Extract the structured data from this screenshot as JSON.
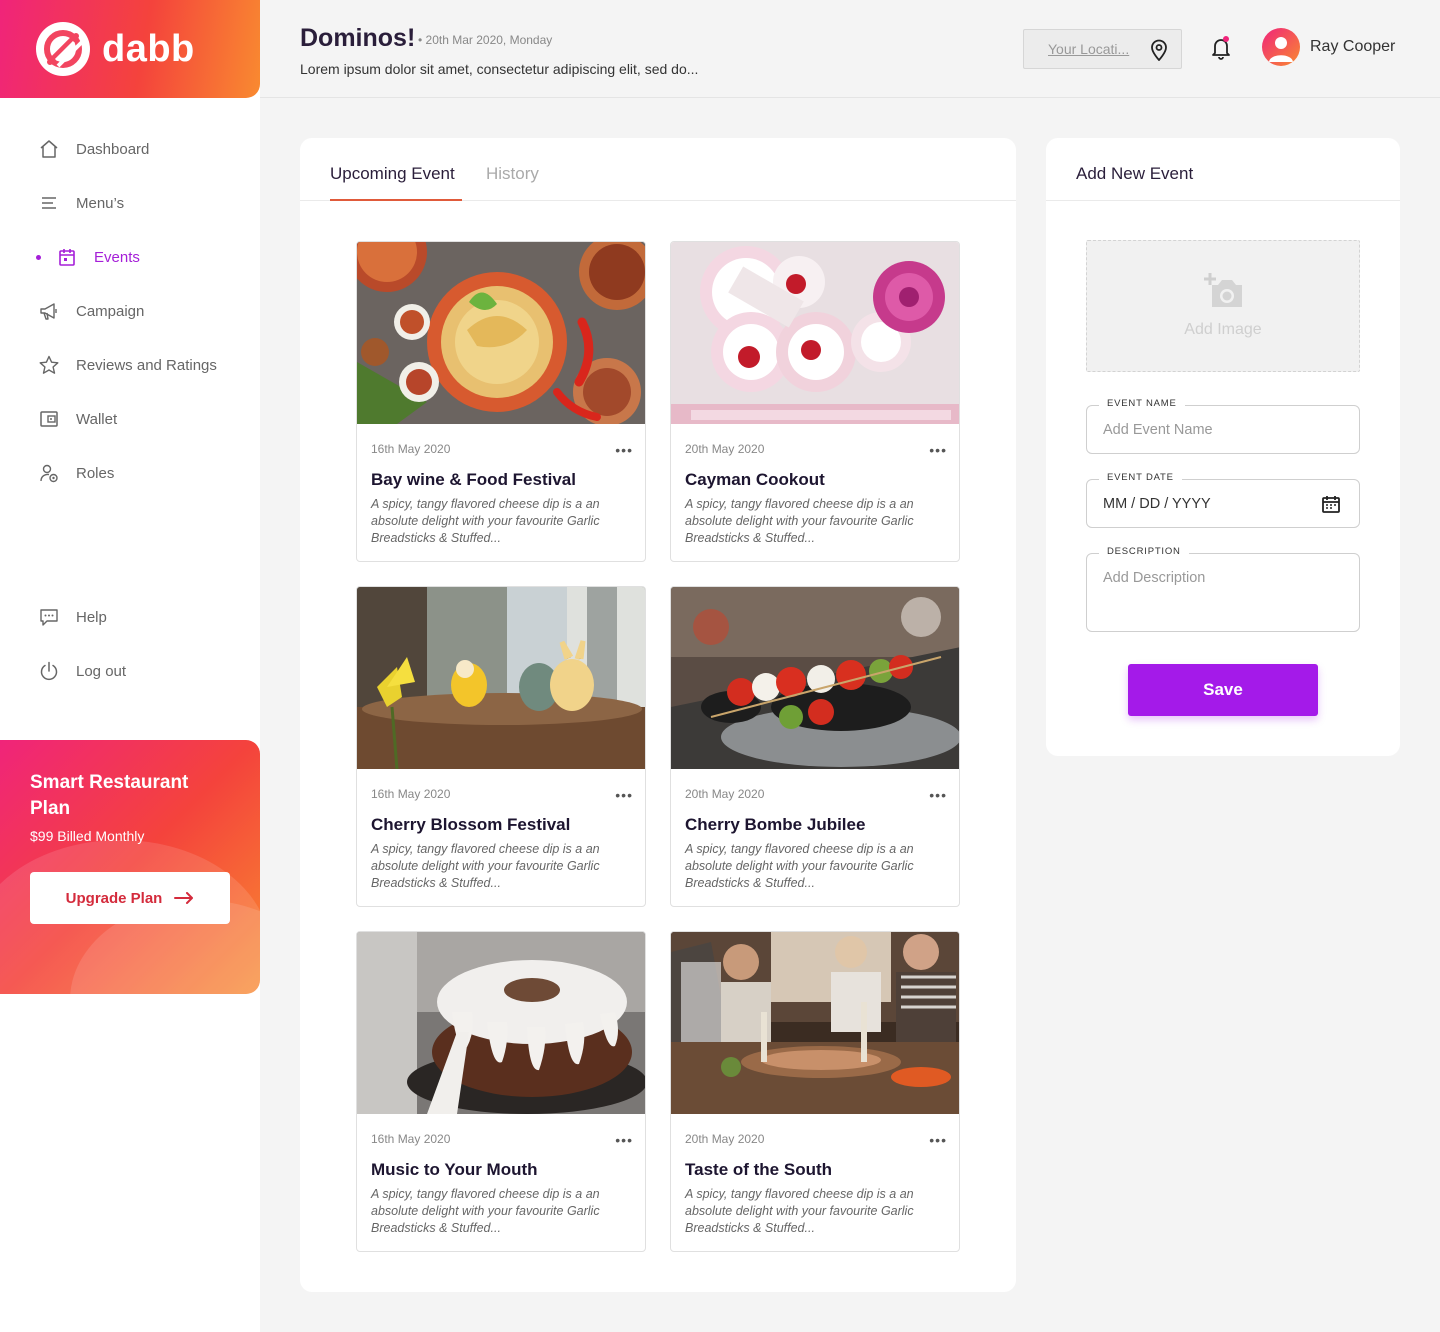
{
  "brand": {
    "name": "dabb"
  },
  "sidebar": {
    "items": [
      {
        "label": "Dashboard",
        "icon": "home-icon"
      },
      {
        "label": "Menu’s",
        "icon": "menu-icon"
      },
      {
        "label": "Events",
        "icon": "calendar-icon",
        "active": true
      },
      {
        "label": "Campaign",
        "icon": "megaphone-icon"
      },
      {
        "label": "Reviews and Ratings",
        "icon": "star-icon"
      },
      {
        "label": "Wallet",
        "icon": "wallet-icon"
      },
      {
        "label": "Roles",
        "icon": "roles-icon"
      }
    ],
    "bottom_items": [
      {
        "label": "Help",
        "icon": "chat-icon"
      },
      {
        "label": "Log out",
        "icon": "power-icon"
      }
    ],
    "promo": {
      "title": "Smart Restaurant Plan",
      "price": "$99 Billed Monthly",
      "button_label": "Upgrade Plan"
    }
  },
  "header": {
    "title": "Dominos!",
    "date": "• 20th Mar 2020, Monday",
    "subtitle": "Lorem ipsum dolor sit amet, consectetur adipiscing elit, sed do...",
    "location_placeholder": "Your Locati...",
    "user_name": "Ray Cooper"
  },
  "events": {
    "tabs": [
      {
        "label": "Upcoming Event",
        "active": true
      },
      {
        "label": "History",
        "active": false
      }
    ],
    "cards": [
      {
        "date": "16th May 2020",
        "title": "Bay wine & Food Festival",
        "description": "A spicy, tangy flavored cheese dip is a an absolute delight with your favourite Garlic Breadsticks & Stuffed...",
        "photo": "noodle-feast"
      },
      {
        "date": "20th May 2020",
        "title": "Cayman Cookout",
        "description": "A spicy, tangy flavored cheese dip is a an absolute delight with your favourite Garlic Breadsticks & Stuffed...",
        "photo": "pink-desserts"
      },
      {
        "date": "16th May 2020",
        "title": "Cherry Blossom Festival",
        "description": "A spicy, tangy flavored cheese dip is a an absolute delight with your favourite Garlic Breadsticks & Stuffed...",
        "photo": "easter-decor"
      },
      {
        "date": "20th May 2020",
        "title": "Cherry Bombe Jubilee",
        "description": "A spicy, tangy flavored cheese dip is a an absolute delight with your favourite Garlic Breadsticks & Stuffed...",
        "photo": "caprese-skewers"
      },
      {
        "date": "16th May 2020",
        "title": "Music to Your Mouth",
        "description": "A spicy, tangy flavored cheese dip is a an absolute delight with your favourite Garlic Breadsticks & Stuffed...",
        "photo": "bundt-cake"
      },
      {
        "date": "20th May 2020",
        "title": "Taste of the South",
        "description": "A spicy, tangy flavored cheese dip is a an absolute delight with your favourite Garlic Breadsticks & Stuffed...",
        "photo": "dinner-party"
      }
    ]
  },
  "add_event": {
    "title": "Add New Event",
    "image_label": "Add Image",
    "fields": {
      "name_label": "EVENT NAME",
      "name_placeholder": "Add Event Name",
      "date_label": "EVENT DATE",
      "date_placeholder": "MM / DD / YYYY",
      "description_label": "DESCRIPTION",
      "description_placeholder": "Add Description"
    },
    "save_label": "Save"
  },
  "colors": {
    "accent": "#a41ae9",
    "brand_gradient_start": "#f0247a",
    "brand_gradient_end": "#f98a30",
    "tab_underline": "#e05a3a"
  }
}
